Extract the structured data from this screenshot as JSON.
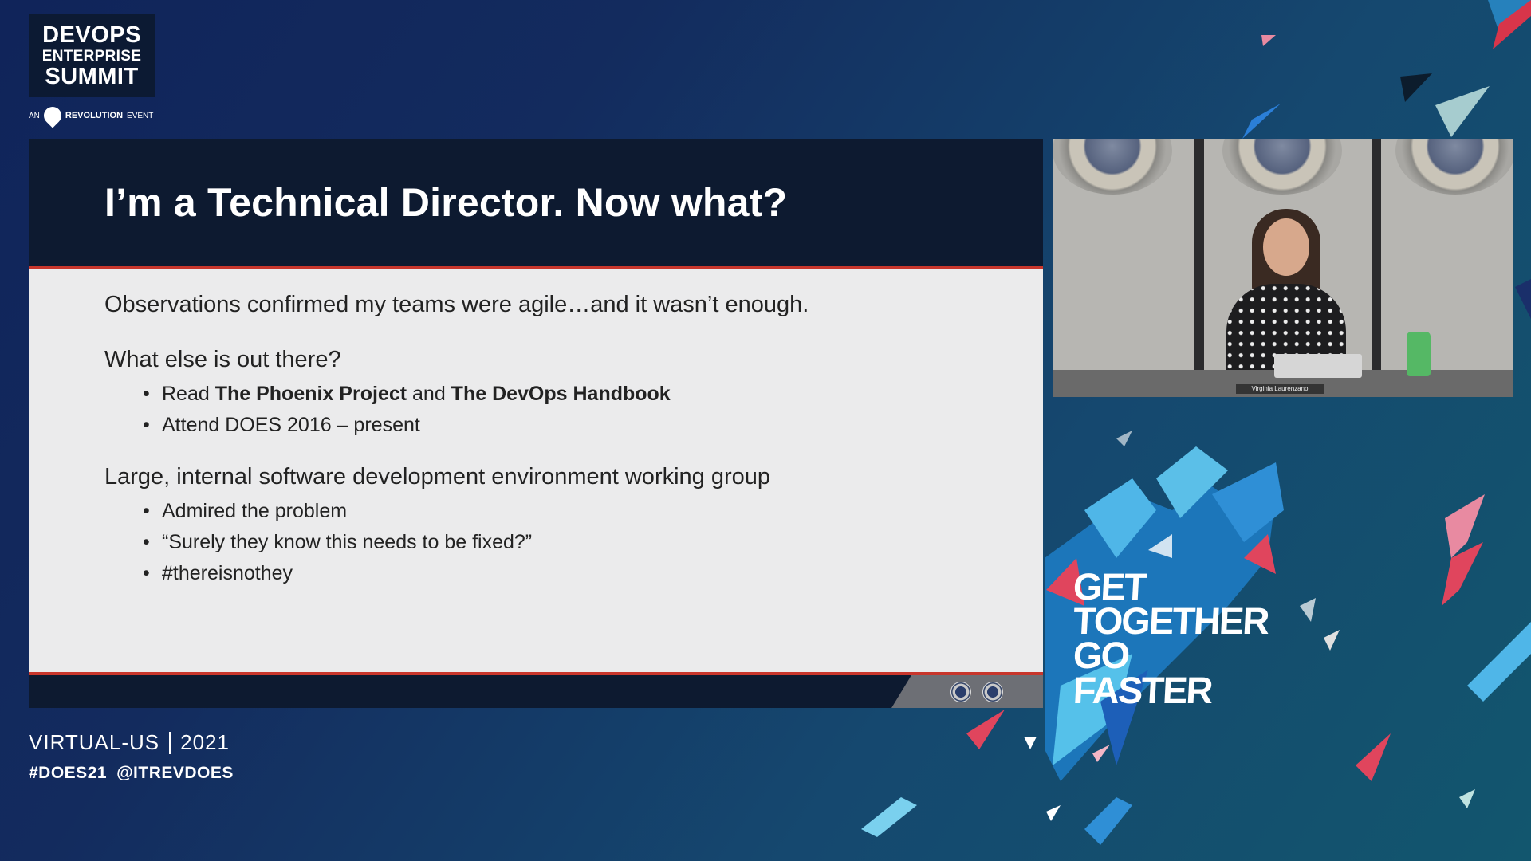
{
  "branding": {
    "logo_line1": "DEVOPS",
    "logo_line2": "ENTERPRISE",
    "logo_line3": "SUMMIT",
    "logo_sub_prefix": "AN",
    "logo_sub_brand": "REVOLUTION",
    "logo_sub_suffix": "EVENT"
  },
  "slide": {
    "title": "I’m a Technical Director. Now what?",
    "intro": "Observations confirmed my teams were agile…and it wasn’t enough.",
    "section1": {
      "heading": "What else is out there?",
      "item1_prefix": "Read ",
      "item1_bold1": "The Phoenix Project",
      "item1_mid": " and ",
      "item1_bold2": "The DevOps Handbook",
      "item2": "Attend DOES 2016 – present"
    },
    "section2": {
      "heading": "Large, internal software development environment working group",
      "items": [
        "Admired the problem",
        "“Surely they know this needs to be fixed?”",
        "#thereisnothey"
      ]
    }
  },
  "video": {
    "name_tag": "Virginia Laurenzano"
  },
  "tagline": {
    "line1": "GET",
    "line2": "TOGETHER",
    "line3": "GO",
    "line4": "FASTER"
  },
  "event": {
    "location": "VIRTUAL-US",
    "year": "2021",
    "hashtag": "#DOES21",
    "handle": "@ITREVDOES"
  },
  "colors": {
    "accent_red": "#c8362c",
    "slide_dark": "#0d1a30",
    "deco_light_blue": "#4fb6e8",
    "deco_pink": "#e0455d"
  }
}
